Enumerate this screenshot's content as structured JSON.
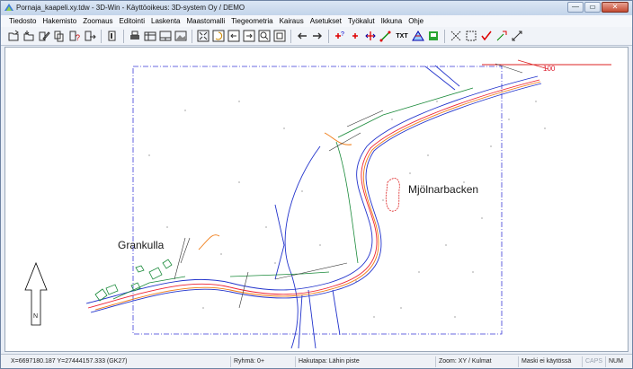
{
  "window": {
    "title": "Pornaja_kaapeli.xy.tdw - 3D-Win - Käyttöoikeus: 3D-system Oy / DEMO"
  },
  "window_buttons": {
    "minimize": "—",
    "maximize": "▭",
    "close": "✕"
  },
  "menu": [
    {
      "label": "Tiedosto"
    },
    {
      "label": "Hakemisto"
    },
    {
      "label": "Zoomaus"
    },
    {
      "label": "Editointi"
    },
    {
      "label": "Laskenta"
    },
    {
      "label": "Maastomalli"
    },
    {
      "label": "Tiegeometria"
    },
    {
      "label": "Kairaus"
    },
    {
      "label": "Asetukset"
    },
    {
      "label": "Työkalut"
    },
    {
      "label": "Ikkuna"
    },
    {
      "label": "Ohje"
    }
  ],
  "toolbar": {
    "txt_label": "TXT"
  },
  "map": {
    "labels": {
      "granskulla": "Grankulla",
      "mjolnarbacken": "Mjölnarbacken",
      "north": "N",
      "scale": "100"
    }
  },
  "status": {
    "coordinates": "X=6697180.187  Y=27444157.333   (GK27)",
    "group": "Ryhmä: 0+",
    "search_mode": "Hakutapa: Lähin piste",
    "zoom": "Zoom: XY  /  Kulmat",
    "mask": "Maski ei käytössä",
    "caps": "CAPS",
    "num": "NUM"
  }
}
